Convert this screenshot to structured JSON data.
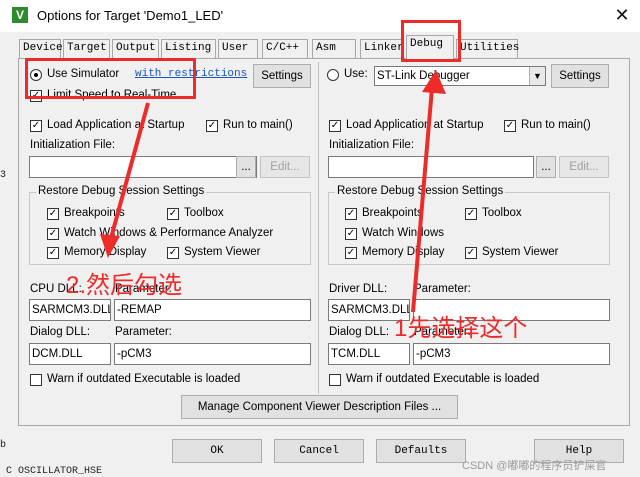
{
  "window": {
    "title": "Options for Target 'Demo1_LED'",
    "app_icon_glyph": "V",
    "close_glyph": "✕"
  },
  "tabs": [
    {
      "label": "Device"
    },
    {
      "label": "Target"
    },
    {
      "label": "Output"
    },
    {
      "label": "Listing"
    },
    {
      "label": "User"
    },
    {
      "label": "C/C++"
    },
    {
      "label": "Asm"
    },
    {
      "label": "Linker"
    },
    {
      "label": "Debug",
      "active": true
    },
    {
      "label": "Utilities"
    }
  ],
  "left": {
    "use_simulator_label": "Use Simulator",
    "use_simulator_selected": true,
    "restrictions_link": "with restrictions",
    "settings_button": "Settings",
    "limit_speed_label": "Limit Speed to Real-Time",
    "limit_speed_checked": true,
    "load_app_label": "Load Application at Startup",
    "run_to_main_label": "Run to main()",
    "init_file_label": "Initialization File:",
    "init_file_value": "",
    "browse_button": "...",
    "edit_button": "Edit...",
    "restore_title": "Restore Debug Session Settings",
    "breakpoints_label": "Breakpoints",
    "toolbox_label": "Toolbox",
    "watch_windows_label": "Watch Windows & Performance Analyzer",
    "memory_display_label": "Memory Display",
    "system_viewer_label": "System Viewer",
    "cpu_dll_label": "CPU DLL:",
    "cpu_dll_value": "SARMCM3.DLL",
    "cpu_param_label": "Parameter:",
    "cpu_param_value": "-REMAP",
    "dialog_dll_label": "Dialog DLL:",
    "dialog_dll_value": "DCM.DLL",
    "dialog_param_label": "Parameter:",
    "dialog_param_value": "-pCM3",
    "warn_label": "Warn if outdated Executable is loaded"
  },
  "right": {
    "use_label": "Use:",
    "use_selected": false,
    "debugger_value": "ST-Link Debugger",
    "settings_button": "Settings",
    "load_app_label": "Load Application at Startup",
    "run_to_main_label": "Run to main()",
    "init_file_label": "Initialization File:",
    "init_file_value": "",
    "browse_button": "...",
    "edit_button": "Edit...",
    "restore_title": "Restore Debug Session Settings",
    "breakpoints_label": "Breakpoints",
    "toolbox_label": "Toolbox",
    "watch_windows_label": "Watch Windows",
    "memory_display_label": "Memory Display",
    "system_viewer_label": "System Viewer",
    "driver_dll_label": "Driver DLL:",
    "driver_dll_value": "SARMCM3.DLL",
    "driver_param_label": "Parameter:",
    "driver_param_value": "",
    "dialog_dll_label": "Dialog DLL:",
    "dialog_dll_value": "TCM.DLL",
    "dialog_param_label": "Parameter:",
    "dialog_param_value": "-pCM3",
    "warn_label": "Warn if outdated Executable is loaded"
  },
  "manage_button": "Manage Component Viewer Description Files ...",
  "footer": {
    "ok": "OK",
    "cancel": "Cancel",
    "defaults": "Defaults",
    "help": "Help"
  },
  "annotations": {
    "step1": "1先选择这个",
    "step2": "2.然后勾选",
    "color": "#ec2b2b"
  },
  "watermark": "CSDN @嘟嘟的程序员铲屎官",
  "background_clip": {
    "side_digit": "3",
    "side_b": "b",
    "bottom_text": "C OSCILLATOR_HSE"
  },
  "check_glyph": "✓"
}
